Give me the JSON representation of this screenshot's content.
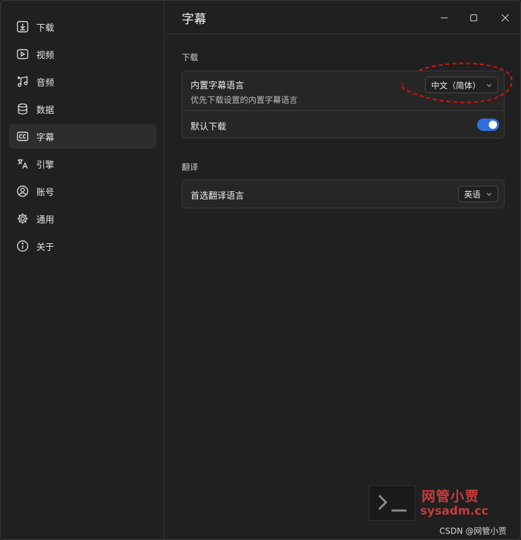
{
  "sidebar": {
    "items": [
      {
        "label": "下载",
        "icon": "download-icon"
      },
      {
        "label": "视频",
        "icon": "video-icon"
      },
      {
        "label": "音频",
        "icon": "music-note-icon"
      },
      {
        "label": "数据",
        "icon": "database-icon"
      },
      {
        "label": "字幕",
        "icon": "closed-caption-icon",
        "active": true
      },
      {
        "label": "引擎",
        "icon": "translate-icon"
      },
      {
        "label": "账号",
        "icon": "account-icon"
      },
      {
        "label": "通用",
        "icon": "gear-icon"
      },
      {
        "label": "关于",
        "icon": "info-icon"
      }
    ]
  },
  "header": {
    "title": "字幕",
    "controls": [
      "minimize-icon",
      "maximize-icon",
      "close-icon"
    ]
  },
  "sections": {
    "download": {
      "title": "下载",
      "embedded_language": {
        "title": "内置字幕语言",
        "subtitle": "优先下载设置的内置字幕语言",
        "value": "中文（简体）"
      },
      "default_download": {
        "title": "默认下载",
        "enabled": true
      }
    },
    "translate": {
      "title": "翻译",
      "preferred_language": {
        "title": "首选翻译语言",
        "value": "英语"
      }
    }
  },
  "watermark": {
    "cn": "网管小贾",
    "en": "sysadm.cc",
    "credit": "CSDN @网管小贾"
  },
  "colors": {
    "background": "#202020",
    "card": "#262626",
    "accent": "#2f6fde",
    "annotation": "#d01010",
    "watermark": "#c93a3a"
  }
}
